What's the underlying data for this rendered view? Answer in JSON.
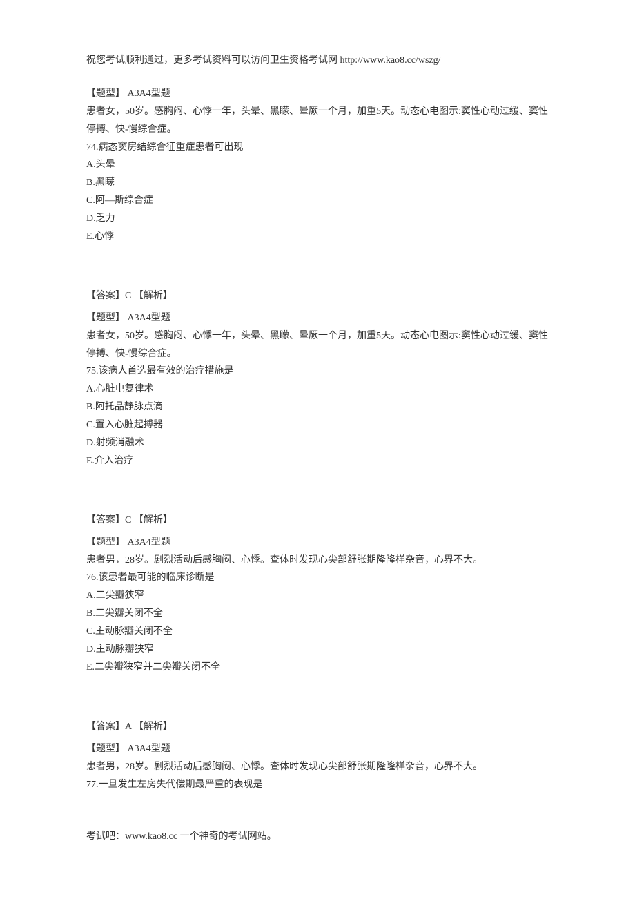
{
  "header": {
    "text": "祝您考试顺利通过，更多考试资料可以访问卫生资格考试网 http://www.kao8.cc/wszg/"
  },
  "questions": [
    {
      "type_label": "【题型】 A3A4型题",
      "stem": "患者女，50岁。感胸闷、心悸一年，头晕、黑矇、晕厥一个月，加重5天。动态心电图示:窦性心动过缓、窦性停搏、快-慢综合症。",
      "prompt": "74.病态窦房结综合征重症患者可出现",
      "options": {
        "A": "A.头晕",
        "B": "B.黑矇",
        "C": "C.阿—斯综合症",
        "D": "D.乏力",
        "E": "E.心悸"
      },
      "answer_label": "【答案】C",
      "analysis_label": "【解析】"
    },
    {
      "type_label": "【题型】 A3A4型题",
      "stem": "患者女，50岁。感胸闷、心悸一年，头晕、黑矇、晕厥一个月，加重5天。动态心电图示:窦性心动过缓、窦性停搏、快-慢综合症。",
      "prompt": "75.该病人首选最有效的治疗措施是",
      "options": {
        "A": "A.心脏电复律术",
        "B": "B.阿托品静脉点滴",
        "C": "C.置入心脏起搏器",
        "D": "D.射频消融术",
        "E": "E.介入治疗"
      },
      "answer_label": "【答案】C",
      "analysis_label": "【解析】"
    },
    {
      "type_label": "【题型】 A3A4型题",
      "stem": "患者男，28岁。剧烈活动后感胸闷、心悸。查体时发现心尖部舒张期隆隆样杂音，心界不大。",
      "prompt": "76.该患者最可能的临床诊断是",
      "options": {
        "A": "A.二尖瓣狭窄",
        "B": "B.二尖瓣关闭不全",
        "C": "C.主动脉瓣关闭不全",
        "D": "D.主动脉瓣狭窄",
        "E": "E.二尖瓣狭窄并二尖瓣关闭不全"
      },
      "answer_label": "【答案】A",
      "analysis_label": "【解析】"
    },
    {
      "type_label": "【题型】 A3A4型题",
      "stem": "患者男，28岁。剧烈活动后感胸闷、心悸。查体时发现心尖部舒张期隆隆样杂音，心界不大。",
      "prompt": "77.一旦发生左房失代偿期最严重的表现是"
    }
  ],
  "footer": {
    "text": "考试吧：www.kao8.cc 一个神奇的考试网站。"
  }
}
